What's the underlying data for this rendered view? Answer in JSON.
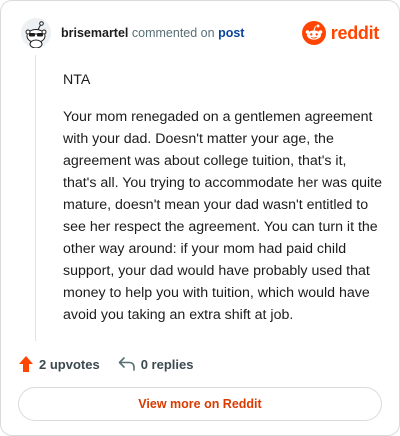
{
  "header": {
    "username": "brisemartel",
    "commented_on_text": "commented on",
    "post_link": "post",
    "brand_name": "reddit"
  },
  "comment": {
    "paragraphs": [
      "NTA",
      "Your mom renegaded on a gentlemen agreement with your dad. Doesn't matter your age, the agreement was about college tuition, that's it, that's all. You trying to accommodate her was quite mature, doesn't mean your dad wasn't entitled to see her respect the agreement. You can turn it the other way around: if your mom had paid child support, your dad would have probably used that money to help you with tuition, which would have avoid you taking an extra shift at job."
    ]
  },
  "actions": {
    "upvotes": "2 upvotes",
    "replies": "0 replies"
  },
  "footer": {
    "view_more": "View more on Reddit"
  },
  "colors": {
    "brand": "#ff4500",
    "link": "#0a449b",
    "view_more": "#d93a00"
  },
  "icons": {
    "avatar": "snoo-sunglasses-avatar",
    "brand": "reddit-logo-icon",
    "upvote": "upvote-arrow-icon",
    "reply": "reply-arrow-icon"
  }
}
